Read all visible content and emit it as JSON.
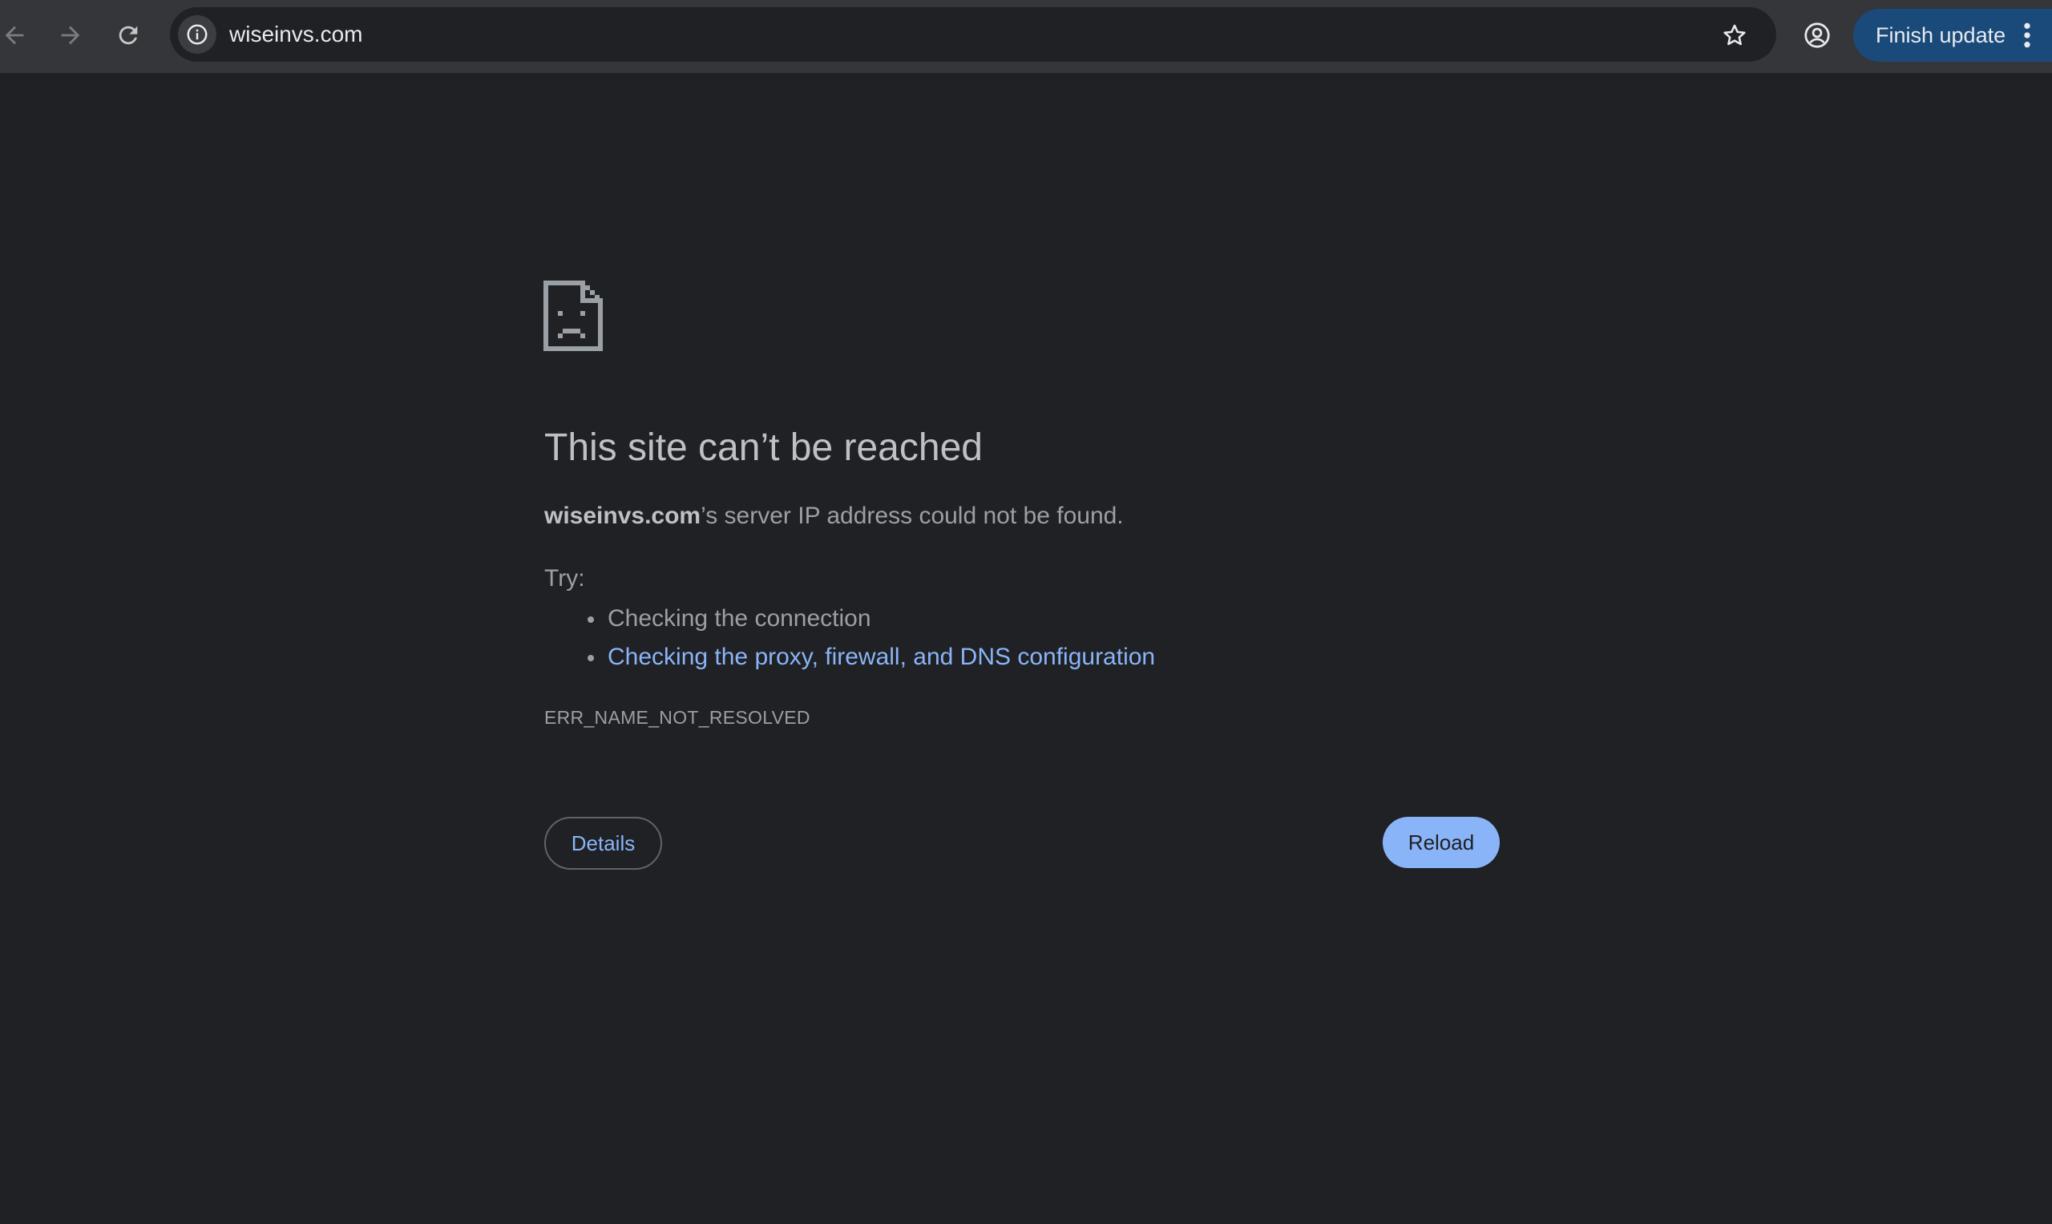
{
  "toolbar": {
    "back_icon": "arrow-left-icon",
    "forward_icon": "arrow-right-icon",
    "reload_icon": "reload-icon",
    "site_info_icon": "info-icon",
    "url": "wiseinvs.com",
    "bookmark_icon": "star-icon",
    "profile_icon": "account-circle-icon",
    "update_label": "Finish update",
    "menu_icon": "more-vert-icon"
  },
  "error": {
    "icon": "sad-page-icon",
    "title": "This site can’t be reached",
    "host": "wiseinvs.com",
    "message_suffix": "’s server IP address could not be found.",
    "try_label": "Try:",
    "suggestions": [
      "Checking the connection",
      "Checking the proxy, firewall, and DNS configuration"
    ],
    "code": "ERR_NAME_NOT_RESOLVED",
    "details_label": "Details",
    "reload_label": "Reload"
  },
  "colors": {
    "page_background": "#202124",
    "toolbar_background": "#35363a",
    "link": "#8ab4f8",
    "update_button": "#1a4a7a"
  }
}
